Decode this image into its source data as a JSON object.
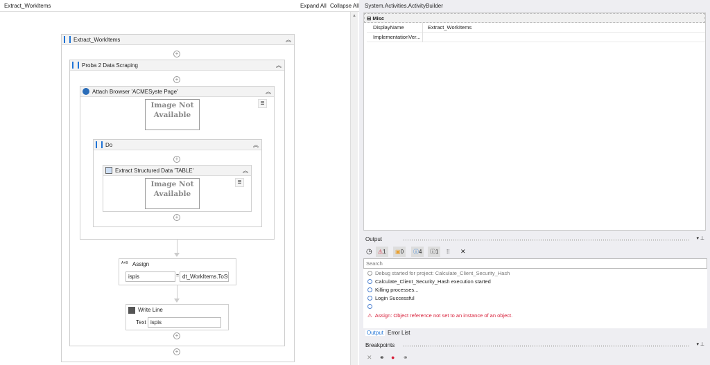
{
  "designer": {
    "title": "Extract_WorkItems",
    "expand_all": "Expand All",
    "collapse_all": "Collapse All",
    "sequence": "Extract_WorkItems",
    "proba": "Proba 2 Data Scraping",
    "attach": "Attach Browser 'ACMESyste Page'",
    "image_na": "Image Not Available",
    "do": "Do",
    "extract": "Extract Structured Data 'TABLE'",
    "assign": {
      "title": "Assign",
      "to": "ispis",
      "eq": "=",
      "value": "dt_WorkItems.ToSt"
    },
    "writeline": {
      "title": "Write Line",
      "label": "Text",
      "value": "ispis"
    }
  },
  "properties": {
    "title": "System.Activities.ActivityBuilder",
    "category": "Misc",
    "rows": [
      {
        "name": "DisplayName",
        "value": "Extract_WorkItems"
      },
      {
        "name": "ImplementationVer...",
        "value": ""
      }
    ]
  },
  "output": {
    "title": "Output",
    "filters": {
      "errors": "1",
      "warnings": "0",
      "info": "4",
      "trace": "1"
    },
    "search_placeholder": "Search",
    "lines": [
      {
        "text": "Debug started for project: Calculate_Client_Security_Hash",
        "level": "trace"
      },
      {
        "text": "Calculate_Client_Security_Hash execution started",
        "level": "info"
      },
      {
        "text": "Killing processes...",
        "level": "info"
      },
      {
        "text": "Login Successful",
        "level": "info"
      },
      {
        "text": "",
        "level": "info"
      },
      {
        "text": "Assign: Object reference not set to an instance of an object.",
        "level": "error"
      }
    ],
    "tabs": [
      "Output",
      "Error List"
    ]
  },
  "breakpoints": {
    "title": "Breakpoints"
  },
  "colors": {
    "accent": "#1e73d6",
    "error": "#d8203a",
    "warning": "#e8a030"
  }
}
